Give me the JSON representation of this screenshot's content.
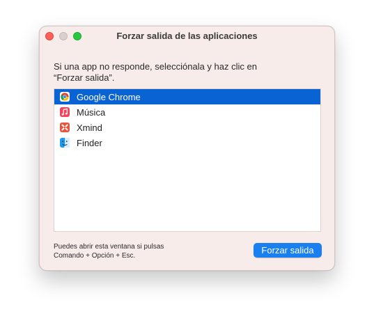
{
  "window": {
    "title": "Forzar salida de las aplicaciones"
  },
  "instructions": {
    "line1": "Si una app no responde, selecciónala y haz clic en",
    "line2": "“Forzar salida”."
  },
  "apps": [
    {
      "label": "Google Chrome",
      "icon": "chrome-icon",
      "selected": true
    },
    {
      "label": "Música",
      "icon": "music-icon",
      "selected": false
    },
    {
      "label": "Xmind",
      "icon": "xmind-icon",
      "selected": false
    },
    {
      "label": "Finder",
      "icon": "finder-icon",
      "selected": false
    }
  ],
  "hint": {
    "line1": "Puedes abrir esta ventana si pulsas",
    "line2": "Comando + Opción + Esc."
  },
  "buttons": {
    "force_quit": "Forzar salida"
  },
  "colors": {
    "accent": "#0a63d3",
    "button": "#1a80f0",
    "window_bg": "#f7ecea",
    "close": "#ff5f57",
    "zoom": "#28c840"
  }
}
